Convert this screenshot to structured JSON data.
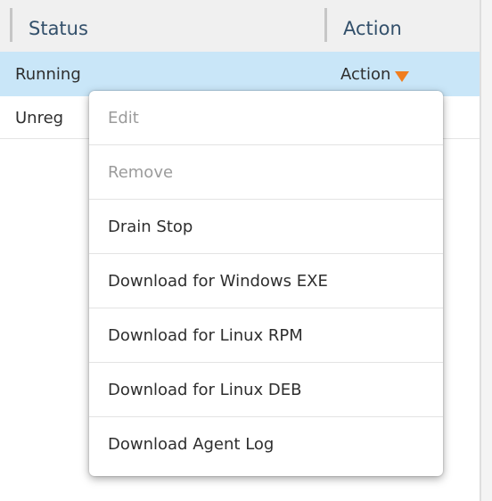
{
  "table": {
    "columns": {
      "status": "Status",
      "action": "Action"
    },
    "rows": [
      {
        "status": "Running",
        "action": "Action",
        "selected": true
      },
      {
        "status": "Unreg",
        "selected": false
      }
    ]
  },
  "menu": {
    "items": [
      {
        "label": "Edit",
        "enabled": false
      },
      {
        "label": "Remove",
        "enabled": false
      },
      {
        "label": "Drain Stop",
        "enabled": true
      },
      {
        "label": "Download for Windows EXE",
        "enabled": true
      },
      {
        "label": "Download for Linux RPM",
        "enabled": true
      },
      {
        "label": "Download for Linux DEB",
        "enabled": true
      },
      {
        "label": "Download Agent Log",
        "enabled": true
      }
    ]
  },
  "colors": {
    "header_text": "#33506b",
    "selected_row": "#c9e6f8",
    "caret": "#f07d1e",
    "disabled_text": "#9b9b9b"
  }
}
